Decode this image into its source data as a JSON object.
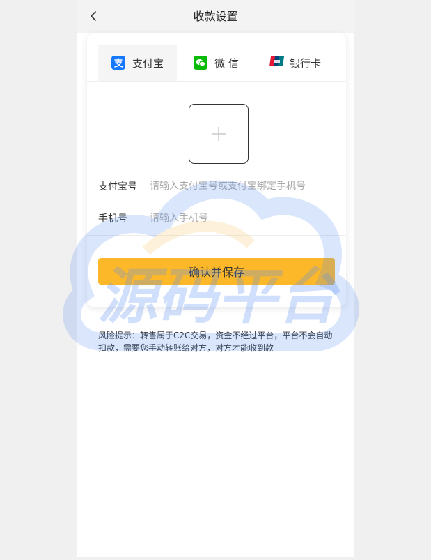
{
  "nav": {
    "title": "收款设置",
    "back_icon": "chevron-left-icon"
  },
  "tabs": [
    {
      "label": "支付宝",
      "icon": "alipay-icon",
      "color": "#1678ff",
      "active": true
    },
    {
      "label": "微 信",
      "icon": "wechat-icon",
      "color": "#09bb07",
      "active": false
    },
    {
      "label": "银行卡",
      "icon": "unionpay-icon",
      "color": "#e21836",
      "active": false
    }
  ],
  "upload": {
    "icon": "plus-icon"
  },
  "form": {
    "account_label": "支付宝号",
    "account_placeholder": "请输入支付宝号或支付宝绑定手机号",
    "account_value": "",
    "phone_label": "手机号",
    "phone_placeholder": "请输入手机号",
    "phone_value": ""
  },
  "save_label": "确认并保存",
  "tip": "风险提示：转售属于C2C交易，资金不经过平台，平台不会自动扣款，需要您手动转账给对方，对方才能收到款",
  "watermark": {
    "text": "源码平台",
    "colors": {
      "blue": "#5b8ff2",
      "orange": "#fcc263"
    }
  },
  "colors": {
    "accent": "#fcb829",
    "topbar": "#f3f3f3",
    "page_bg": "#f0f0f0"
  }
}
